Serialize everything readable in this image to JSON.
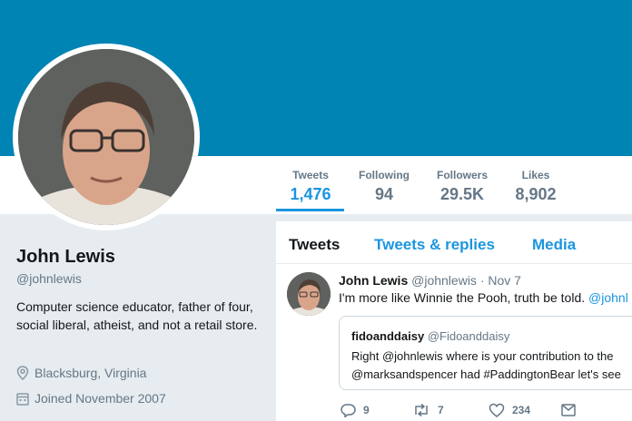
{
  "profile": {
    "name": "John Lewis",
    "handle": "@johnlewis",
    "bio": "Computer science educator, father of four, social liberal, atheist, and not a retail store.",
    "location": "Blacksburg, Virginia",
    "joined": "Joined November 2007"
  },
  "stats": [
    {
      "label": "Tweets",
      "value": "1,476"
    },
    {
      "label": "Following",
      "value": "94"
    },
    {
      "label": "Followers",
      "value": "29.5K"
    },
    {
      "label": "Likes",
      "value": "8,902"
    }
  ],
  "tabs": [
    {
      "label": "Tweets"
    },
    {
      "label": "Tweets & replies"
    },
    {
      "label": "Media"
    }
  ],
  "tweet": {
    "name": "John Lewis",
    "handle": "@johnlewis",
    "separator": " · ",
    "date": "Nov 7",
    "text_before": "I'm more like Winnie the Pooh, truth be told. ",
    "text_link": "@johnl",
    "quote": {
      "name": "fidoanddaisy",
      "handle": "@Fidoanddaisy",
      "line1": "Right @johnlewis where is your contribution to the",
      "line2": "@marksandspencer had #PaddingtonBear let's see"
    },
    "actions": {
      "replies": "9",
      "retweets": "7",
      "likes": "234"
    }
  },
  "colors": {
    "banner": "#0084b4",
    "accent": "#1b95e0",
    "background": "#e6ecf0"
  },
  "icons": [
    "location-icon",
    "calendar-icon",
    "reply-icon",
    "retweet-icon",
    "like-icon",
    "message-icon"
  ]
}
